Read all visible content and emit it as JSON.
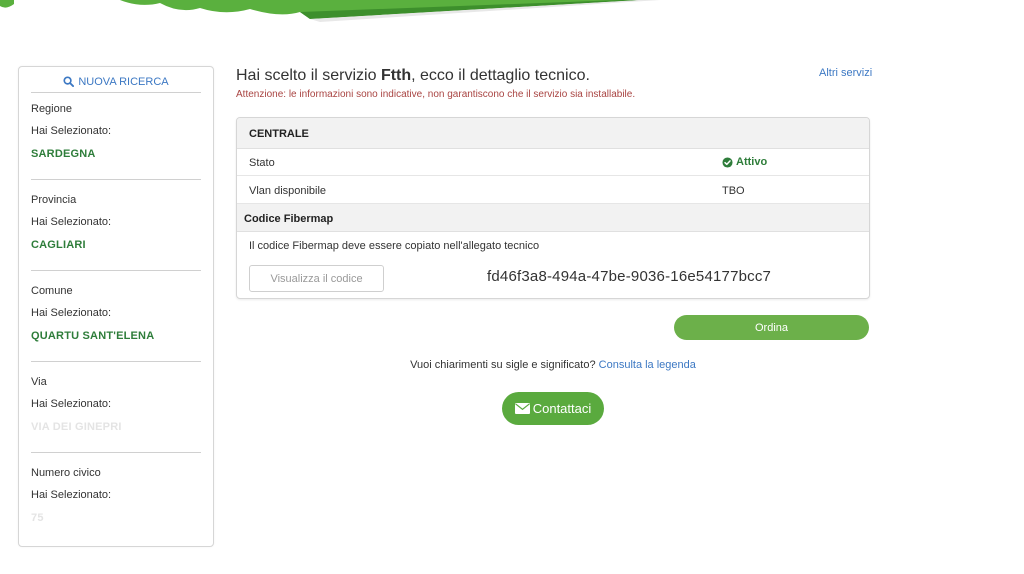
{
  "sidebar": {
    "new_search": "NUOVA RICERCA",
    "filters": [
      {
        "label": "Regione",
        "selected_label": "Hai Selezionato:",
        "value": "SARDEGNA"
      },
      {
        "label": "Provincia",
        "selected_label": "Hai Selezionato:",
        "value": "CAGLIARI"
      },
      {
        "label": "Comune",
        "selected_label": "Hai Selezionato:",
        "value": "QUARTU SANT'ELENA"
      },
      {
        "label": "Via",
        "selected_label": "Hai Selezionato:",
        "value": "VIA DEI GINEPRI"
      },
      {
        "label": "Numero civico",
        "selected_label": "Hai Selezionato:",
        "value": "75"
      }
    ]
  },
  "header": {
    "title_prefix": "Hai scelto il servizio ",
    "service": "Ftth",
    "title_suffix": ", ecco il dettaglio tecnico.",
    "warning": "Attenzione: le informazioni sono indicative, non garantiscono che il servizio sia installabile.",
    "other_services": "Altri servizi"
  },
  "panel": {
    "heading": "CENTRALE",
    "rows": [
      {
        "key": "Stato",
        "value": "Attivo"
      },
      {
        "key": "Vlan disponibile",
        "value": "TBO"
      }
    ],
    "fibermap_heading": "Codice Fibermap",
    "fibermap_note": "Il codice Fibermap deve essere copiato nell'allegato tecnico",
    "view_code_button": "Visualizza il codice",
    "code": "fd46f3a8-494a-47be-9036-16e54177bcc7"
  },
  "actions": {
    "order_button": "Ordina",
    "legend_question": "Vuoi chiarimenti su sigle e significato?",
    "legend_link": "Consulta la legenda",
    "contact_button": "Contattaci"
  },
  "icons": {
    "search": "search-icon",
    "check": "check-circle-icon",
    "envelope": "envelope-icon"
  },
  "colors": {
    "brand_green": "#5aaa3e",
    "value_green": "#2e7d3a",
    "link_blue": "#3c78c3",
    "warning_red": "#a94442"
  }
}
